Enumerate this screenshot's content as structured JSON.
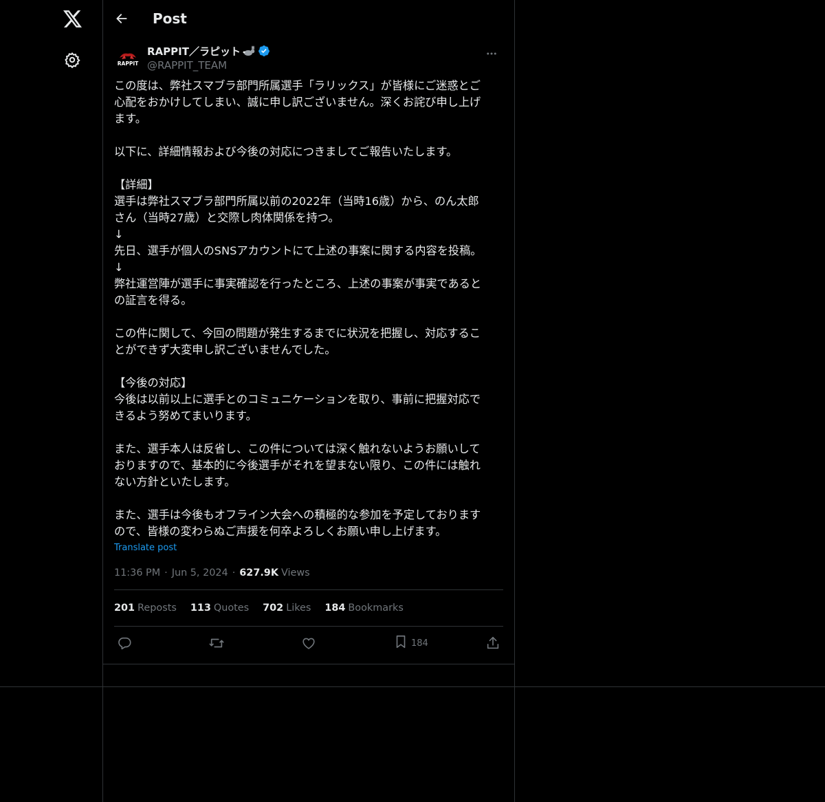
{
  "header": {
    "title": "Post",
    "back_icon": "arrow-left-icon"
  },
  "nav": {
    "logo_icon": "x-logo-icon",
    "settings_icon": "gear-icon"
  },
  "post": {
    "display_name": "RAPPIT／ラピット",
    "name_emoji": "rabbit-icon",
    "verified_icon": "verified-badge-icon",
    "handle": "@RAPPIT_TEAM",
    "avatar_text": "RAPPIT",
    "body": [
      "この度は、弊社スマブラ部門所属選手「ラリックス」が皆様にご迷惑とご\n心配をおかけしてしまい、誠に申し訳ございません。深くお詫び申し上げ\nます。",
      "",
      "以下に、詳細情報および今後の対応につきましてご報告いたします。",
      "",
      "【詳細】\n選手は弊社スマブラ部門所属以前の2022年（当時16歳）から、のん太郎\nさん（当時27歳）と交際し肉体関係を持つ。\n↓\n先日、選手が個人のSNSアカウントにて上述の事案に関する内容を投稿。\n↓\n弊社運営陣が選手に事実確認を行ったところ、上述の事案が事実であると\nの証言を得る。",
      "",
      "この件に関して、今回の問題が発生するまでに状況を把握し、対応するこ\nとができず大変申し訳ございませんでした。",
      "",
      "【今後の対応】\n今後は以前以上に選手とのコミュニケーションを取り、事前に把握対応で\nきるよう努めてまいります。",
      "",
      "また、選手本人は反省し、この件については深く触れないようお願いして\nおりますので、基本的に今後選手がそれを望まない限り、この件には触れ\nない方針といたします。",
      "",
      "また、選手は今後もオフライン大会への積極的な参加を予定しております\nので、皆様の変わらぬご声援を何卒よろしくお願い申し上げます。"
    ],
    "translate_label": "Translate post",
    "time": "11:36 PM",
    "date": "Jun 5, 2024",
    "separator": "·",
    "views_count": "627.9K",
    "views_label": "Views",
    "stats": {
      "reposts_count": "201",
      "reposts_label": "Reposts",
      "quotes_count": "113",
      "quotes_label": "Quotes",
      "likes_count": "702",
      "likes_label": "Likes",
      "bookmarks_count": "184",
      "bookmarks_label": "Bookmarks"
    },
    "actions": {
      "reply_icon": "reply-icon",
      "repost_icon": "repost-icon",
      "like_icon": "heart-icon",
      "bookmark_icon": "bookmark-icon",
      "bookmark_count": "184",
      "share_icon": "share-icon"
    }
  },
  "colors": {
    "background": "#000000",
    "text": "#e7e9ea",
    "muted": "#71767b",
    "accent": "#1d9bf0",
    "border": "#2f3336"
  }
}
